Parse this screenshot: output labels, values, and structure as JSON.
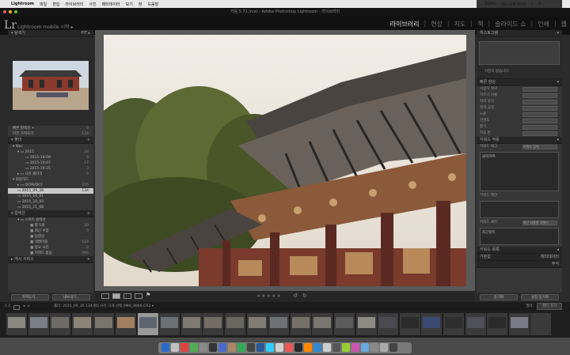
{
  "menubar": {
    "app": "Lightroom",
    "items": [
      "파일",
      "편집",
      "라이브러리",
      "사진",
      "메타데이터",
      "보기",
      "창",
      "도움말"
    ],
    "status": "100%",
    "clock": "(목) 오후 6:15"
  },
  "window": {
    "title": "카를 5.71.lrcat - Adobe Photoshop Lightroom - 라이브러리"
  },
  "identity": {
    "logo": "Lr",
    "mobile": "Lightroom mobile 시작 ▸",
    "modules": [
      "라이브러리",
      "현상",
      "지도",
      "책",
      "슬라이드 쇼",
      "인쇄",
      "웹"
    ],
    "active_module": "라이브러리"
  },
  "left": {
    "navigator": "탐색기",
    "catalog_rows": [
      {
        "label": "빠른 컬렉션 +",
        "count": "0"
      },
      {
        "label": "이전 가져오기",
        "count": "134"
      }
    ],
    "folders_head": "폴더",
    "volume": {
      "label": "Mac",
      "count": ""
    },
    "folders": [
      {
        "label": "2015",
        "count": "24"
      },
      {
        "label": "2015-10-09",
        "count": "4"
      },
      {
        "label": "2015-10-07",
        "count": "17"
      },
      {
        "label": "2015-10-25",
        "count": "3"
      },
      {
        "label": "사진 폴더리",
        "count": "9"
      }
    ],
    "drive": "외장하드",
    "drive_rows": [
      {
        "label": "DCIM/DCF",
        "count": "275"
      },
      {
        "label": "2015_09_26",
        "count": "134",
        "selected": true
      },
      {
        "label": "2015_10_01",
        "count": ""
      },
      {
        "label": "2015_10_03",
        "count": ""
      },
      {
        "label": "2015_11_08",
        "count": ""
      }
    ],
    "collections_head": "컬렉션",
    "collections": [
      {
        "label": "스마트 컬렉션",
        "count": ""
      },
      {
        "label": "별 5개",
        "count": "20"
      },
      {
        "label": "최근 수정",
        "count": "0"
      },
      {
        "label": "동영상",
        "count": ""
      },
      {
        "label": "색레이블",
        "count": "119"
      },
      {
        "label": "중요 사진",
        "count": "0"
      },
      {
        "label": "키워드 없음",
        "count": "495"
      }
    ],
    "publish_head": "게시 서비스",
    "import_btn": "가져오기...",
    "export_btn": "내보내기..."
  },
  "right": {
    "histogram": "히스토그램",
    "histogram_label": "사진이 없습니다",
    "quick_develop": "빠른 현상",
    "qd_rows": [
      "사용자 정의",
      "자르기 비율",
      "처리 방식",
      "흰색 균형",
      "노출",
      "선명도",
      "활기",
      "자동 톤"
    ],
    "keywording": "키워드 적용",
    "kw_tags_label": "키워드 태그",
    "kw_tags_value": "키워드 입력",
    "kw_click": "클릭하여",
    "kw_suggest": "키워드 제안",
    "kw_set": "키워드 세트",
    "kw_set_value": "최근 사용한 키워드",
    "kw_empty": "최근항목",
    "keyword_list": "키워드 목록",
    "metadata_select": "기본값",
    "metadata": "메타데이터",
    "comments": "주석",
    "sync_btn": "동기화",
    "sync_settings_btn": "설정 동기화"
  },
  "toolbar": {
    "stars": "★★★★★"
  },
  "filmstrip": {
    "page": "1 2",
    "path": "폴더: 2015_09_26    134개의 사진 /1개 선택 /IMG_8966.CR2 ▾",
    "filter_label": "필터:",
    "filter_value": "필터 끄기"
  }
}
